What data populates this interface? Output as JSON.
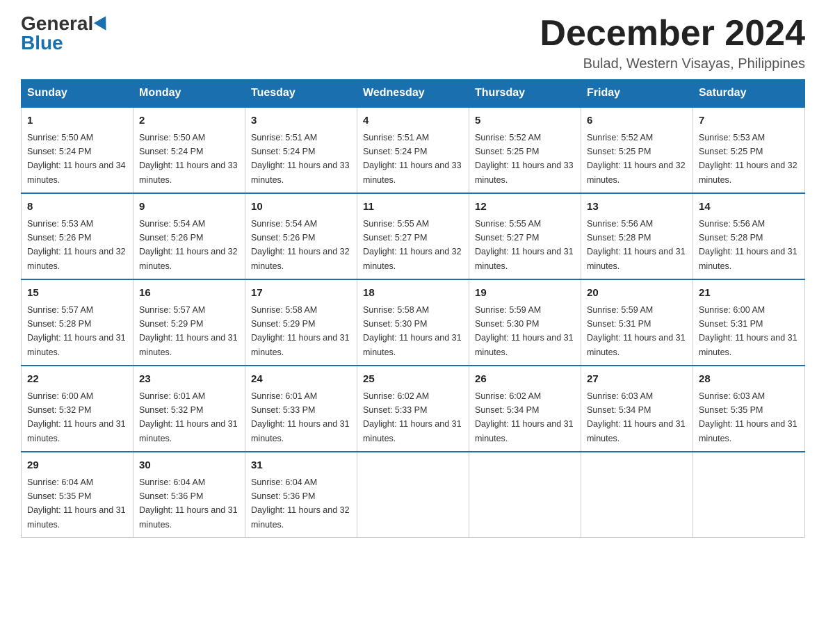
{
  "header": {
    "logo_general": "General",
    "logo_blue": "Blue",
    "month_title": "December 2024",
    "location": "Bulad, Western Visayas, Philippines"
  },
  "weekdays": [
    "Sunday",
    "Monday",
    "Tuesday",
    "Wednesday",
    "Thursday",
    "Friday",
    "Saturday"
  ],
  "weeks": [
    [
      {
        "day": "1",
        "sunrise": "5:50 AM",
        "sunset": "5:24 PM",
        "daylight": "11 hours and 34 minutes."
      },
      {
        "day": "2",
        "sunrise": "5:50 AM",
        "sunset": "5:24 PM",
        "daylight": "11 hours and 33 minutes."
      },
      {
        "day": "3",
        "sunrise": "5:51 AM",
        "sunset": "5:24 PM",
        "daylight": "11 hours and 33 minutes."
      },
      {
        "day": "4",
        "sunrise": "5:51 AM",
        "sunset": "5:24 PM",
        "daylight": "11 hours and 33 minutes."
      },
      {
        "day": "5",
        "sunrise": "5:52 AM",
        "sunset": "5:25 PM",
        "daylight": "11 hours and 33 minutes."
      },
      {
        "day": "6",
        "sunrise": "5:52 AM",
        "sunset": "5:25 PM",
        "daylight": "11 hours and 32 minutes."
      },
      {
        "day": "7",
        "sunrise": "5:53 AM",
        "sunset": "5:25 PM",
        "daylight": "11 hours and 32 minutes."
      }
    ],
    [
      {
        "day": "8",
        "sunrise": "5:53 AM",
        "sunset": "5:26 PM",
        "daylight": "11 hours and 32 minutes."
      },
      {
        "day": "9",
        "sunrise": "5:54 AM",
        "sunset": "5:26 PM",
        "daylight": "11 hours and 32 minutes."
      },
      {
        "day": "10",
        "sunrise": "5:54 AM",
        "sunset": "5:26 PM",
        "daylight": "11 hours and 32 minutes."
      },
      {
        "day": "11",
        "sunrise": "5:55 AM",
        "sunset": "5:27 PM",
        "daylight": "11 hours and 32 minutes."
      },
      {
        "day": "12",
        "sunrise": "5:55 AM",
        "sunset": "5:27 PM",
        "daylight": "11 hours and 31 minutes."
      },
      {
        "day": "13",
        "sunrise": "5:56 AM",
        "sunset": "5:28 PM",
        "daylight": "11 hours and 31 minutes."
      },
      {
        "day": "14",
        "sunrise": "5:56 AM",
        "sunset": "5:28 PM",
        "daylight": "11 hours and 31 minutes."
      }
    ],
    [
      {
        "day": "15",
        "sunrise": "5:57 AM",
        "sunset": "5:28 PM",
        "daylight": "11 hours and 31 minutes."
      },
      {
        "day": "16",
        "sunrise": "5:57 AM",
        "sunset": "5:29 PM",
        "daylight": "11 hours and 31 minutes."
      },
      {
        "day": "17",
        "sunrise": "5:58 AM",
        "sunset": "5:29 PM",
        "daylight": "11 hours and 31 minutes."
      },
      {
        "day": "18",
        "sunrise": "5:58 AM",
        "sunset": "5:30 PM",
        "daylight": "11 hours and 31 minutes."
      },
      {
        "day": "19",
        "sunrise": "5:59 AM",
        "sunset": "5:30 PM",
        "daylight": "11 hours and 31 minutes."
      },
      {
        "day": "20",
        "sunrise": "5:59 AM",
        "sunset": "5:31 PM",
        "daylight": "11 hours and 31 minutes."
      },
      {
        "day": "21",
        "sunrise": "6:00 AM",
        "sunset": "5:31 PM",
        "daylight": "11 hours and 31 minutes."
      }
    ],
    [
      {
        "day": "22",
        "sunrise": "6:00 AM",
        "sunset": "5:32 PM",
        "daylight": "11 hours and 31 minutes."
      },
      {
        "day": "23",
        "sunrise": "6:01 AM",
        "sunset": "5:32 PM",
        "daylight": "11 hours and 31 minutes."
      },
      {
        "day": "24",
        "sunrise": "6:01 AM",
        "sunset": "5:33 PM",
        "daylight": "11 hours and 31 minutes."
      },
      {
        "day": "25",
        "sunrise": "6:02 AM",
        "sunset": "5:33 PM",
        "daylight": "11 hours and 31 minutes."
      },
      {
        "day": "26",
        "sunrise": "6:02 AM",
        "sunset": "5:34 PM",
        "daylight": "11 hours and 31 minutes."
      },
      {
        "day": "27",
        "sunrise": "6:03 AM",
        "sunset": "5:34 PM",
        "daylight": "11 hours and 31 minutes."
      },
      {
        "day": "28",
        "sunrise": "6:03 AM",
        "sunset": "5:35 PM",
        "daylight": "11 hours and 31 minutes."
      }
    ],
    [
      {
        "day": "29",
        "sunrise": "6:04 AM",
        "sunset": "5:35 PM",
        "daylight": "11 hours and 31 minutes."
      },
      {
        "day": "30",
        "sunrise": "6:04 AM",
        "sunset": "5:36 PM",
        "daylight": "11 hours and 31 minutes."
      },
      {
        "day": "31",
        "sunrise": "6:04 AM",
        "sunset": "5:36 PM",
        "daylight": "11 hours and 32 minutes."
      },
      null,
      null,
      null,
      null
    ]
  ]
}
